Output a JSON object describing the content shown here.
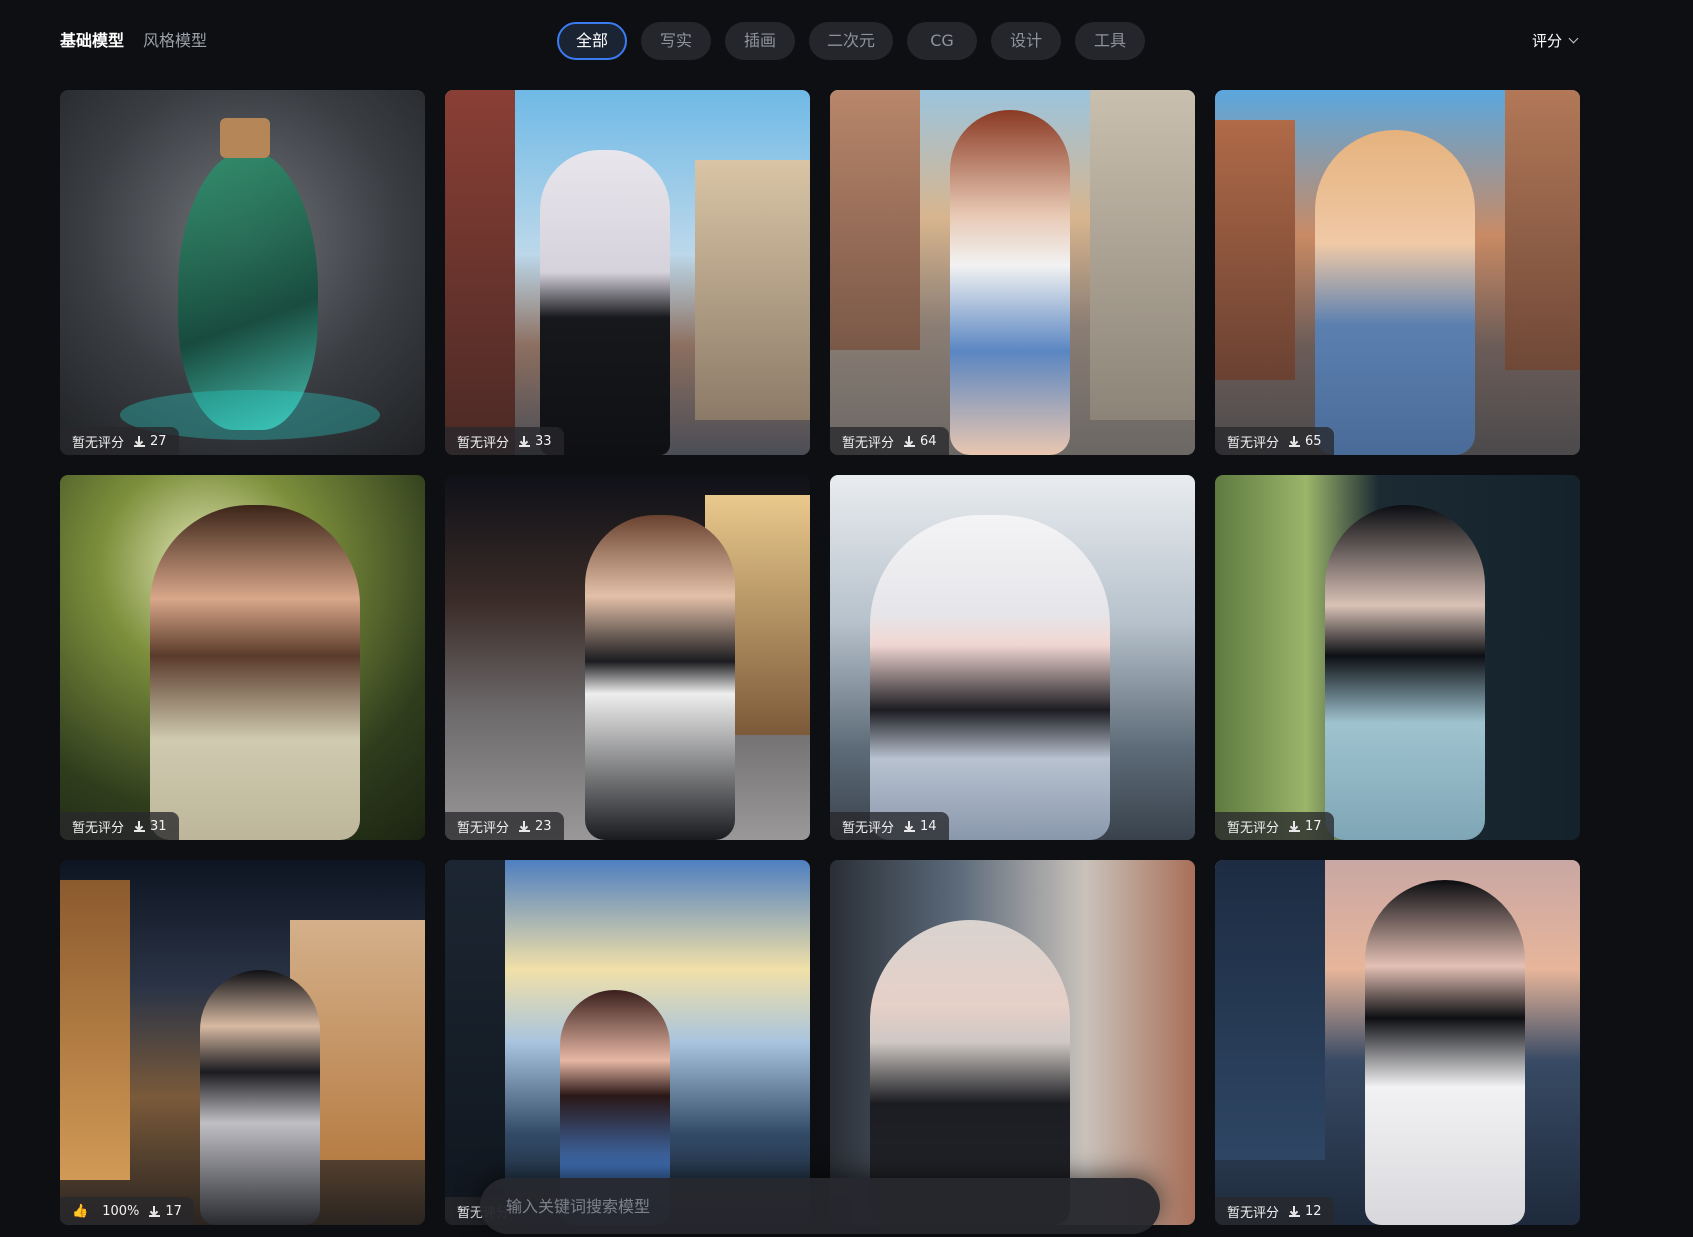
{
  "header": {
    "model_tabs": [
      {
        "label": "基础模型",
        "active": true
      },
      {
        "label": "风格模型",
        "active": false
      }
    ],
    "filters": [
      {
        "label": "全部",
        "active": true
      },
      {
        "label": "写实",
        "active": false
      },
      {
        "label": "插画",
        "active": false
      },
      {
        "label": "二次元",
        "active": false
      },
      {
        "label": "CG",
        "active": false
      },
      {
        "label": "设计",
        "active": false
      },
      {
        "label": "工具",
        "active": false
      }
    ],
    "sort_label": "评分"
  },
  "cards": [
    {
      "rating": "暂无评分",
      "downloads": "27",
      "rating_icon": "none"
    },
    {
      "rating": "暂无评分",
      "downloads": "33",
      "rating_icon": "none"
    },
    {
      "rating": "暂无评分",
      "downloads": "64",
      "rating_icon": "none"
    },
    {
      "rating": "暂无评分",
      "downloads": "65",
      "rating_icon": "none"
    },
    {
      "rating": "暂无评分",
      "downloads": "31",
      "rating_icon": "none"
    },
    {
      "rating": "暂无评分",
      "downloads": "23",
      "rating_icon": "none"
    },
    {
      "rating": "暂无评分",
      "downloads": "14",
      "rating_icon": "none"
    },
    {
      "rating": "暂无评分",
      "downloads": "17",
      "rating_icon": "none"
    },
    {
      "rating": "100%",
      "downloads": "17",
      "rating_icon": "thumbs-up-icon"
    },
    {
      "rating": "暂无评分",
      "downloads": "",
      "rating_icon": "none"
    },
    {
      "rating": "",
      "downloads": "",
      "rating_icon": "none"
    },
    {
      "rating": "暂无评分",
      "downloads": "12",
      "rating_icon": "none"
    }
  ],
  "search": {
    "placeholder": "输入关键词搜索模型"
  },
  "colors": {
    "accent": "#3a7cf2",
    "background": "#0e0f12",
    "chip": "#24262b"
  },
  "icons": {
    "download": "download-icon",
    "sort": "chevron-down-icon",
    "like": "thumbs-up-icon"
  }
}
